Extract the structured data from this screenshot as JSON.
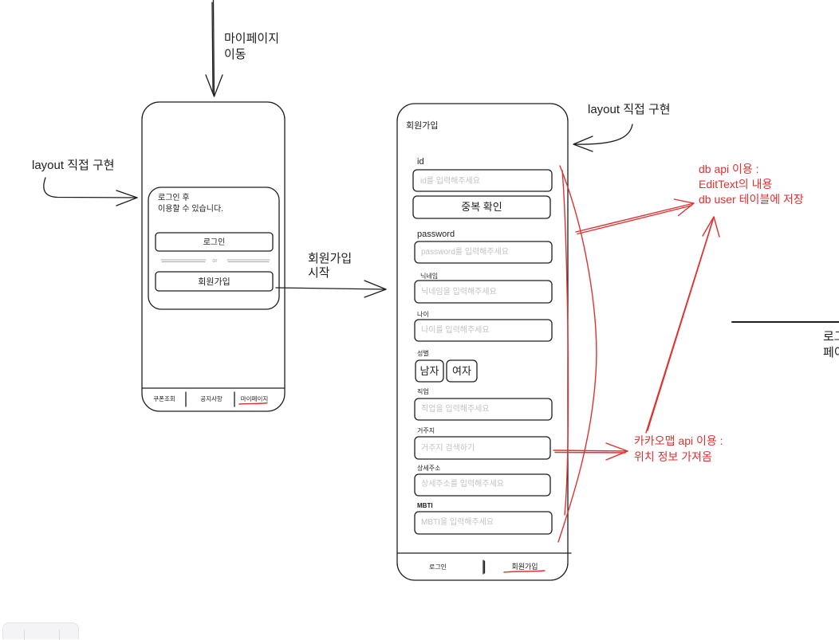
{
  "colors": {
    "ink": "#1e1e1e",
    "annotation": "#e03131",
    "placeholder": "#c2c2c2"
  },
  "annotations": {
    "to_mypage_label": [
      "마이페이지",
      "이동"
    ],
    "left_layout_note": "layout 직접 구현",
    "right_layout_note": "layout 직접 구현",
    "signup_start_label": [
      "회원가입",
      "시작"
    ],
    "db_note": [
      "db api 이용 :",
      "EditText의 내용",
      "db user 테이블에 저장"
    ],
    "kakao_note": [
      "카카오맵 api 이용 :",
      "위치 정보 가져옴"
    ],
    "clipped_note": [
      "로그",
      "페이"
    ]
  },
  "login_screen": {
    "notice": [
      "로그인 후",
      "이용할 수 있습니다."
    ],
    "login_button": "로그인",
    "divider_text": "or",
    "signup_button": "회원가입",
    "tabs": [
      {
        "label": "쿠폰조회",
        "active": false
      },
      {
        "label": "공지사항",
        "active": false
      },
      {
        "label": "마이페이지",
        "active": true
      }
    ]
  },
  "signup_screen": {
    "title": "회원가입",
    "fields": [
      {
        "label": "id",
        "placeholder": "id를 입력해주세요"
      },
      {
        "label": "password",
        "placeholder": "password를 입력해주세요"
      },
      {
        "label": "닉네임",
        "placeholder": "닉네임을 입력해주세요"
      },
      {
        "label": "나이",
        "placeholder": "나이를 입력해주세요"
      },
      {
        "label": "직업",
        "placeholder": "직업을 입력해주세요"
      },
      {
        "label": "거주지",
        "placeholder": "거주지 검색하기"
      },
      {
        "label": "상세주소",
        "placeholder": "상세주소를 입력해주세요"
      },
      {
        "label": "MBTI",
        "placeholder": "MBTI을 입력해주세요"
      }
    ],
    "duplicate_check_button": "중복 확인",
    "gender": {
      "label": "성별",
      "options": [
        "남자",
        "여자"
      ]
    },
    "tabs": [
      {
        "label": "로그인",
        "active": false
      },
      {
        "label": "회원가입",
        "active": true
      }
    ]
  }
}
